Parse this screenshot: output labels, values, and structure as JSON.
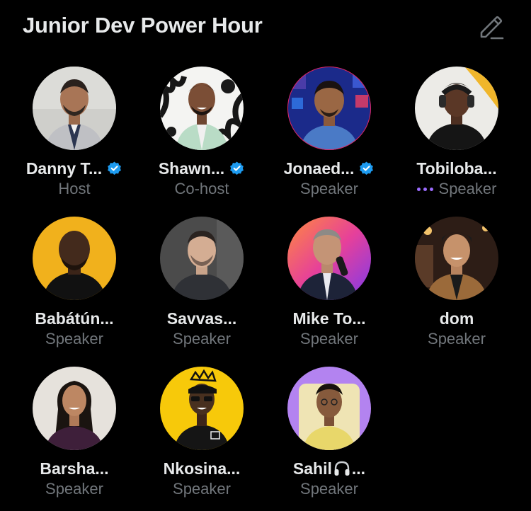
{
  "space": {
    "title": "Junior Dev Power Hour"
  },
  "icons": {
    "edit": "edit-pencil-icon",
    "verified": "verified-badge-icon",
    "speaking": "speaking-dots-icon",
    "headphones": "headphones-icon"
  },
  "colors": {
    "background": "#000000",
    "text_primary": "#e7e9ea",
    "text_secondary": "#71767b",
    "verified": "#1d9bf0",
    "speaking": "#9c6cff"
  },
  "participants": [
    {
      "name": "Danny T...",
      "role": "Host",
      "verified": true
    },
    {
      "name": "Shawn...",
      "role": "Co-host",
      "verified": true
    },
    {
      "name": "Jonaed...",
      "role": "Speaker",
      "verified": true
    },
    {
      "name": "Tobiloba...",
      "role": "Speaker",
      "verified": false,
      "speaking": true
    },
    {
      "name": "Babátún...",
      "role": "Speaker",
      "verified": false
    },
    {
      "name": "Savvas...",
      "role": "Speaker",
      "verified": false
    },
    {
      "name": "Mike To...",
      "role": "Speaker",
      "verified": false
    },
    {
      "name": "dom",
      "role": "Speaker",
      "verified": false
    },
    {
      "name": "Barsha...",
      "role": "Speaker",
      "verified": false
    },
    {
      "name": "Nkosina...",
      "role": "Speaker",
      "verified": false
    },
    {
      "name_prefix": "Sahil",
      "name_suffix": "...",
      "role": "Speaker",
      "verified": false
    }
  ]
}
